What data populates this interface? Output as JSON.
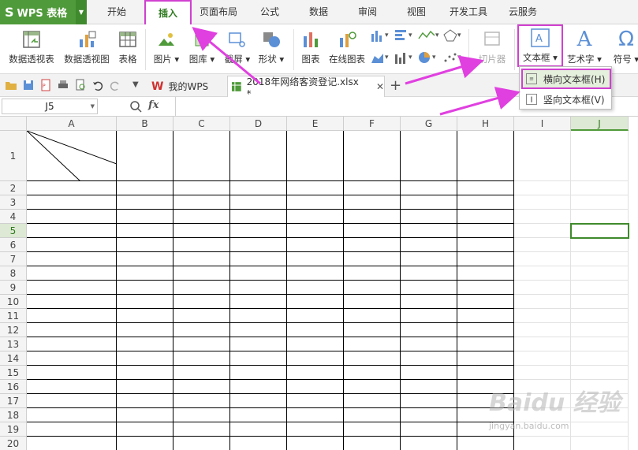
{
  "app": {
    "logo": "S",
    "title": "WPS 表格"
  },
  "tabs": [
    "开始",
    "插入",
    "页面布局",
    "公式",
    "数据",
    "审阅",
    "视图",
    "开发工具",
    "云服务"
  ],
  "ribbon": {
    "pivot_table": "数据透视表",
    "pivot_chart": "数据透视图",
    "table": "表格",
    "picture": "图片",
    "gallery": "图库",
    "screenshot": "截屏",
    "shapes": "形状",
    "chart": "图表",
    "online_chart": "在线图表",
    "slicer": "切片器",
    "textbox": "文本框",
    "wordart": "艺术字",
    "symbol": "符号"
  },
  "quickbar": {
    "home_tab": "我的WPS",
    "doc_tab": "2018年网络客资登记.xlsx *",
    "add_tab": "+"
  },
  "formula": {
    "namebox": "J5",
    "fx": "fx"
  },
  "columns": [
    "A",
    "B",
    "C",
    "D",
    "E",
    "F",
    "G",
    "H",
    "I",
    "J"
  ],
  "rows": [
    "1",
    "2",
    "3",
    "4",
    "5",
    "6",
    "7",
    "8",
    "9",
    "10",
    "11",
    "12",
    "13",
    "14",
    "15",
    "16",
    "17",
    "18",
    "19",
    "20"
  ],
  "dropdown": {
    "horizontal": "横向文本框(H)",
    "vertical": "竖向文本框(V)"
  },
  "watermark": {
    "brand": "Baidu 经验",
    "url": "jingyan.baidu.com"
  },
  "colors": {
    "accent": "#4f9a3a",
    "highlight": "#d040d0",
    "arrow": "#e040e0"
  }
}
